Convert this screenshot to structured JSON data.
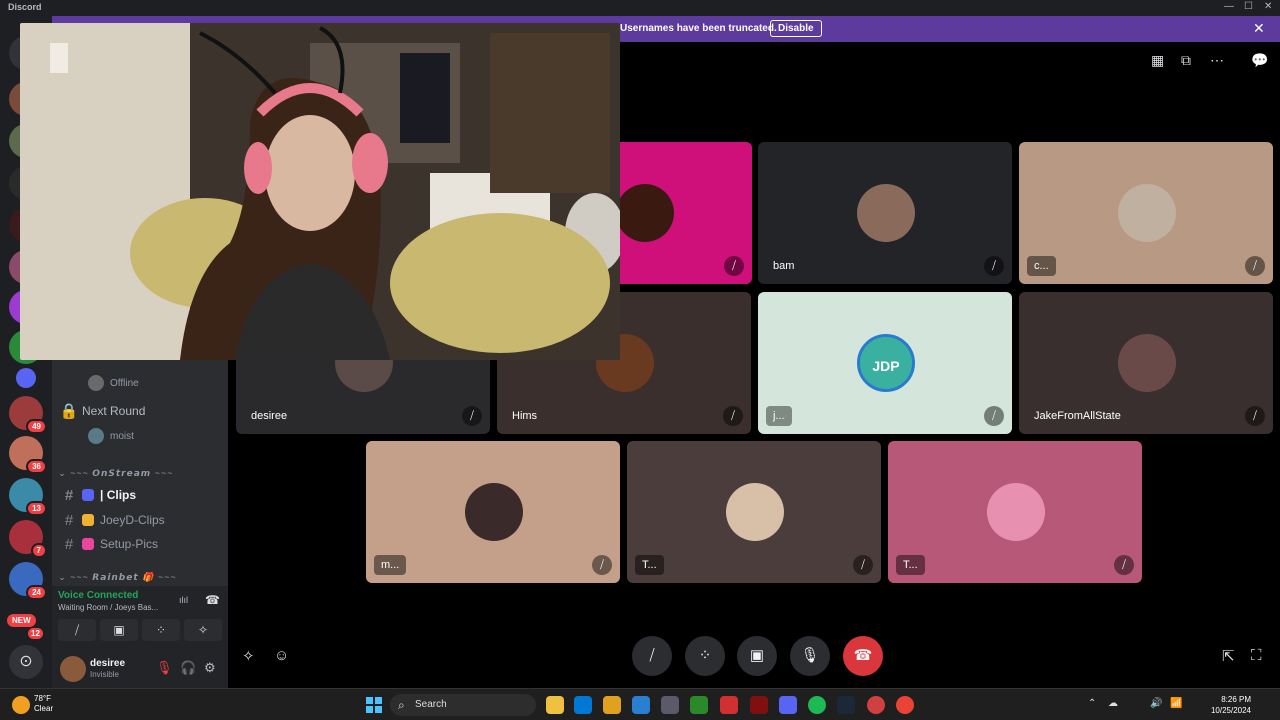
{
  "window": {
    "title": "Discord",
    "min": "—",
    "max": "☐",
    "close": "✕"
  },
  "banner": {
    "text": "Usernames have been truncated.",
    "button": "Disable",
    "close": "✕"
  },
  "servers": [
    {
      "color": "#9b3b3b",
      "badge": "49"
    },
    {
      "color": "#c0705a",
      "badge": "36"
    },
    {
      "color": "#3a8aa8",
      "badge": "13"
    },
    {
      "color": "#a8303c",
      "badge": "7"
    },
    {
      "color": "#3a6ac0",
      "badge": "24"
    }
  ],
  "new_badge": "NEW",
  "new_badge_count": "12",
  "discover_icon": "⊙",
  "sidebar": {
    "voice_users": [
      {
        "name": "Offline"
      },
      {
        "name": "moist"
      }
    ],
    "locked_channel": "Next Round",
    "lock_icon": "🔒",
    "category_onstream": "⌄ ~~~ 𝙊𝙣𝙎𝙩𝙧𝙚𝙖𝙢 ~~~",
    "category_rainbet": "⌄ ~~~ 𝙍𝙖𝙞𝙣𝙗𝙚𝙩 🎁 ~~~",
    "hash": "#",
    "channels": [
      {
        "label": "| Clips",
        "emoji_color": "#5865f2",
        "active": true
      },
      {
        "label": "JoeyD-Clips",
        "emoji_color": "#f0b232"
      },
      {
        "label": "Setup-Pics",
        "emoji_color": "#eb459e"
      }
    ]
  },
  "voice_panel": {
    "status": "Voice Connected",
    "room": "Waiting Room / Joeys Bas...",
    "buttons": [
      "⧸",
      "▣",
      "⁘",
      "✧"
    ],
    "signal_icon": "ılıl",
    "disconnect_icon": "☎"
  },
  "user_panel": {
    "name": "desiree",
    "status": "Invisible",
    "mic_icon": "🎙",
    "headset_icon": "🎧",
    "settings_icon": "⚙"
  },
  "top_icons": [
    "▦",
    "⧉",
    "⋯",
    "💬"
  ],
  "tiles": [
    {
      "name": "",
      "bg": "#d0107a",
      "avatar": "#3a1a10"
    },
    {
      "name": "bam",
      "bg": "#232428",
      "avatar": "#8a6a5a"
    },
    {
      "name": "c...",
      "bg": "#b89a84",
      "avatar": "#c0b0a0"
    },
    {
      "name": "desiree",
      "bg": "#2a2a2c",
      "avatar": "#5a4a48"
    },
    {
      "name": "Hims",
      "bg": "#3a2f2d",
      "avatar": "#6a3a20"
    },
    {
      "name": "j...",
      "bg": "#d4e6dc",
      "avatar": "#3ab0a0"
    },
    {
      "name": "JakeFromAllState",
      "bg": "#3a2f2f",
      "avatar": "#6a4a48"
    },
    {
      "name": "m...",
      "bg": "#c4a08a",
      "avatar": "#3a2a2a"
    },
    {
      "name": "T...",
      "bg": "#4a3d3b",
      "avatar": "#d8c0a8"
    },
    {
      "name": "T...",
      "bg": "#b85878",
      "avatar": "#e890b0"
    }
  ],
  "avatar_text": "JDP",
  "mute_icon": "⧸",
  "controls": [
    "⧸",
    "⁘",
    "▣",
    "🎙",
    "☎"
  ],
  "left_corner_icons": [
    "✧",
    "☺"
  ],
  "right_corner_icons": [
    "⇱",
    "⛶"
  ],
  "taskbar": {
    "weather_temp": "78°F",
    "weather_desc": "Clear",
    "search": "Search",
    "search_icon": "⌕",
    "tray_chevron": "⌃",
    "tray_icons": [
      "☁",
      "🔊",
      "📶"
    ],
    "time": "8:26 PM",
    "date": "10/25/2024",
    "apps": [
      "#f0c040",
      "#0078d4",
      "#e0a020",
      "#2a80d0",
      "#5865f2",
      "#d03030",
      "#1db954",
      "#1b2838",
      "#d04040",
      "#ea4335"
    ]
  }
}
